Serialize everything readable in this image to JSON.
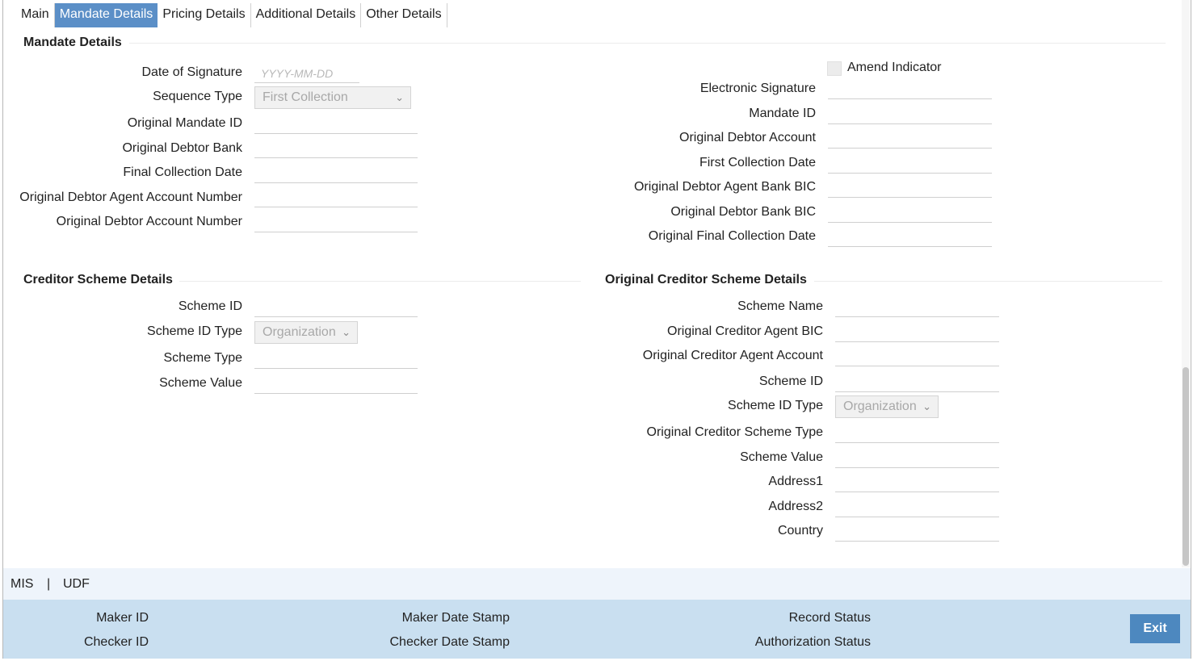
{
  "tabs": [
    "Main",
    "Mandate Details",
    "Pricing Details",
    "Additional Details",
    "Other Details"
  ],
  "active_tab": "Mandate Details",
  "mandate": {
    "title": "Mandate Details",
    "left": {
      "date_of_signature": "Date of Signature",
      "date_placeholder": "YYYY-MM-DD",
      "sequence_type": "Sequence Type",
      "sequence_type_value": "First Collection",
      "original_mandate_id": "Original Mandate ID",
      "original_debtor_bank": "Original Debtor Bank",
      "final_collection_date": "Final Collection Date",
      "orig_debtor_agent_acct_no": "Original Debtor Agent Account Number",
      "orig_debtor_acct_no": "Original Debtor Account Number"
    },
    "right": {
      "amend_indicator": "Amend Indicator",
      "electronic_signature": "Electronic Signature",
      "mandate_id": "Mandate ID",
      "original_debtor_account": "Original Debtor Account",
      "first_collection_date": "First Collection Date",
      "orig_debtor_agent_bank_bic": "Original Debtor Agent Bank BIC",
      "orig_debtor_bank_bic": "Original Debtor Bank BIC",
      "orig_final_collection_date": "Original Final Collection Date"
    }
  },
  "creditor_scheme": {
    "title": "Creditor Scheme Details",
    "scheme_id": "Scheme ID",
    "scheme_id_type": "Scheme ID Type",
    "scheme_id_type_value": "Organization",
    "scheme_type": "Scheme Type",
    "scheme_value": "Scheme Value"
  },
  "orig_creditor_scheme": {
    "title": "Original Creditor Scheme Details",
    "scheme_name": "Scheme Name",
    "orig_creditor_agent_bic": "Original Creditor Agent BIC",
    "orig_creditor_agent_account": "Original Creditor Agent Account",
    "scheme_id": "Scheme ID",
    "scheme_id_type": "Scheme ID Type",
    "scheme_id_type_value": "Organization",
    "orig_creditor_scheme_type": "Original Creditor Scheme Type",
    "scheme_value": "Scheme Value",
    "address1": "Address1",
    "address2": "Address2",
    "country": "Country"
  },
  "links": {
    "mis": "MIS",
    "separator": "|",
    "udf": "UDF"
  },
  "footer": {
    "maker_id": "Maker ID",
    "checker_id": "Checker ID",
    "maker_date_stamp": "Maker Date Stamp",
    "checker_date_stamp": "Checker Date Stamp",
    "record_status": "Record Status",
    "authorization_status": "Authorization Status",
    "exit": "Exit"
  },
  "colors": {
    "active_tab": "#5b8fc7",
    "footer_bg": "#c9dff0",
    "exit_button": "#4d88bf"
  },
  "icons": {
    "select_chevron": "chevron-down-icon"
  }
}
